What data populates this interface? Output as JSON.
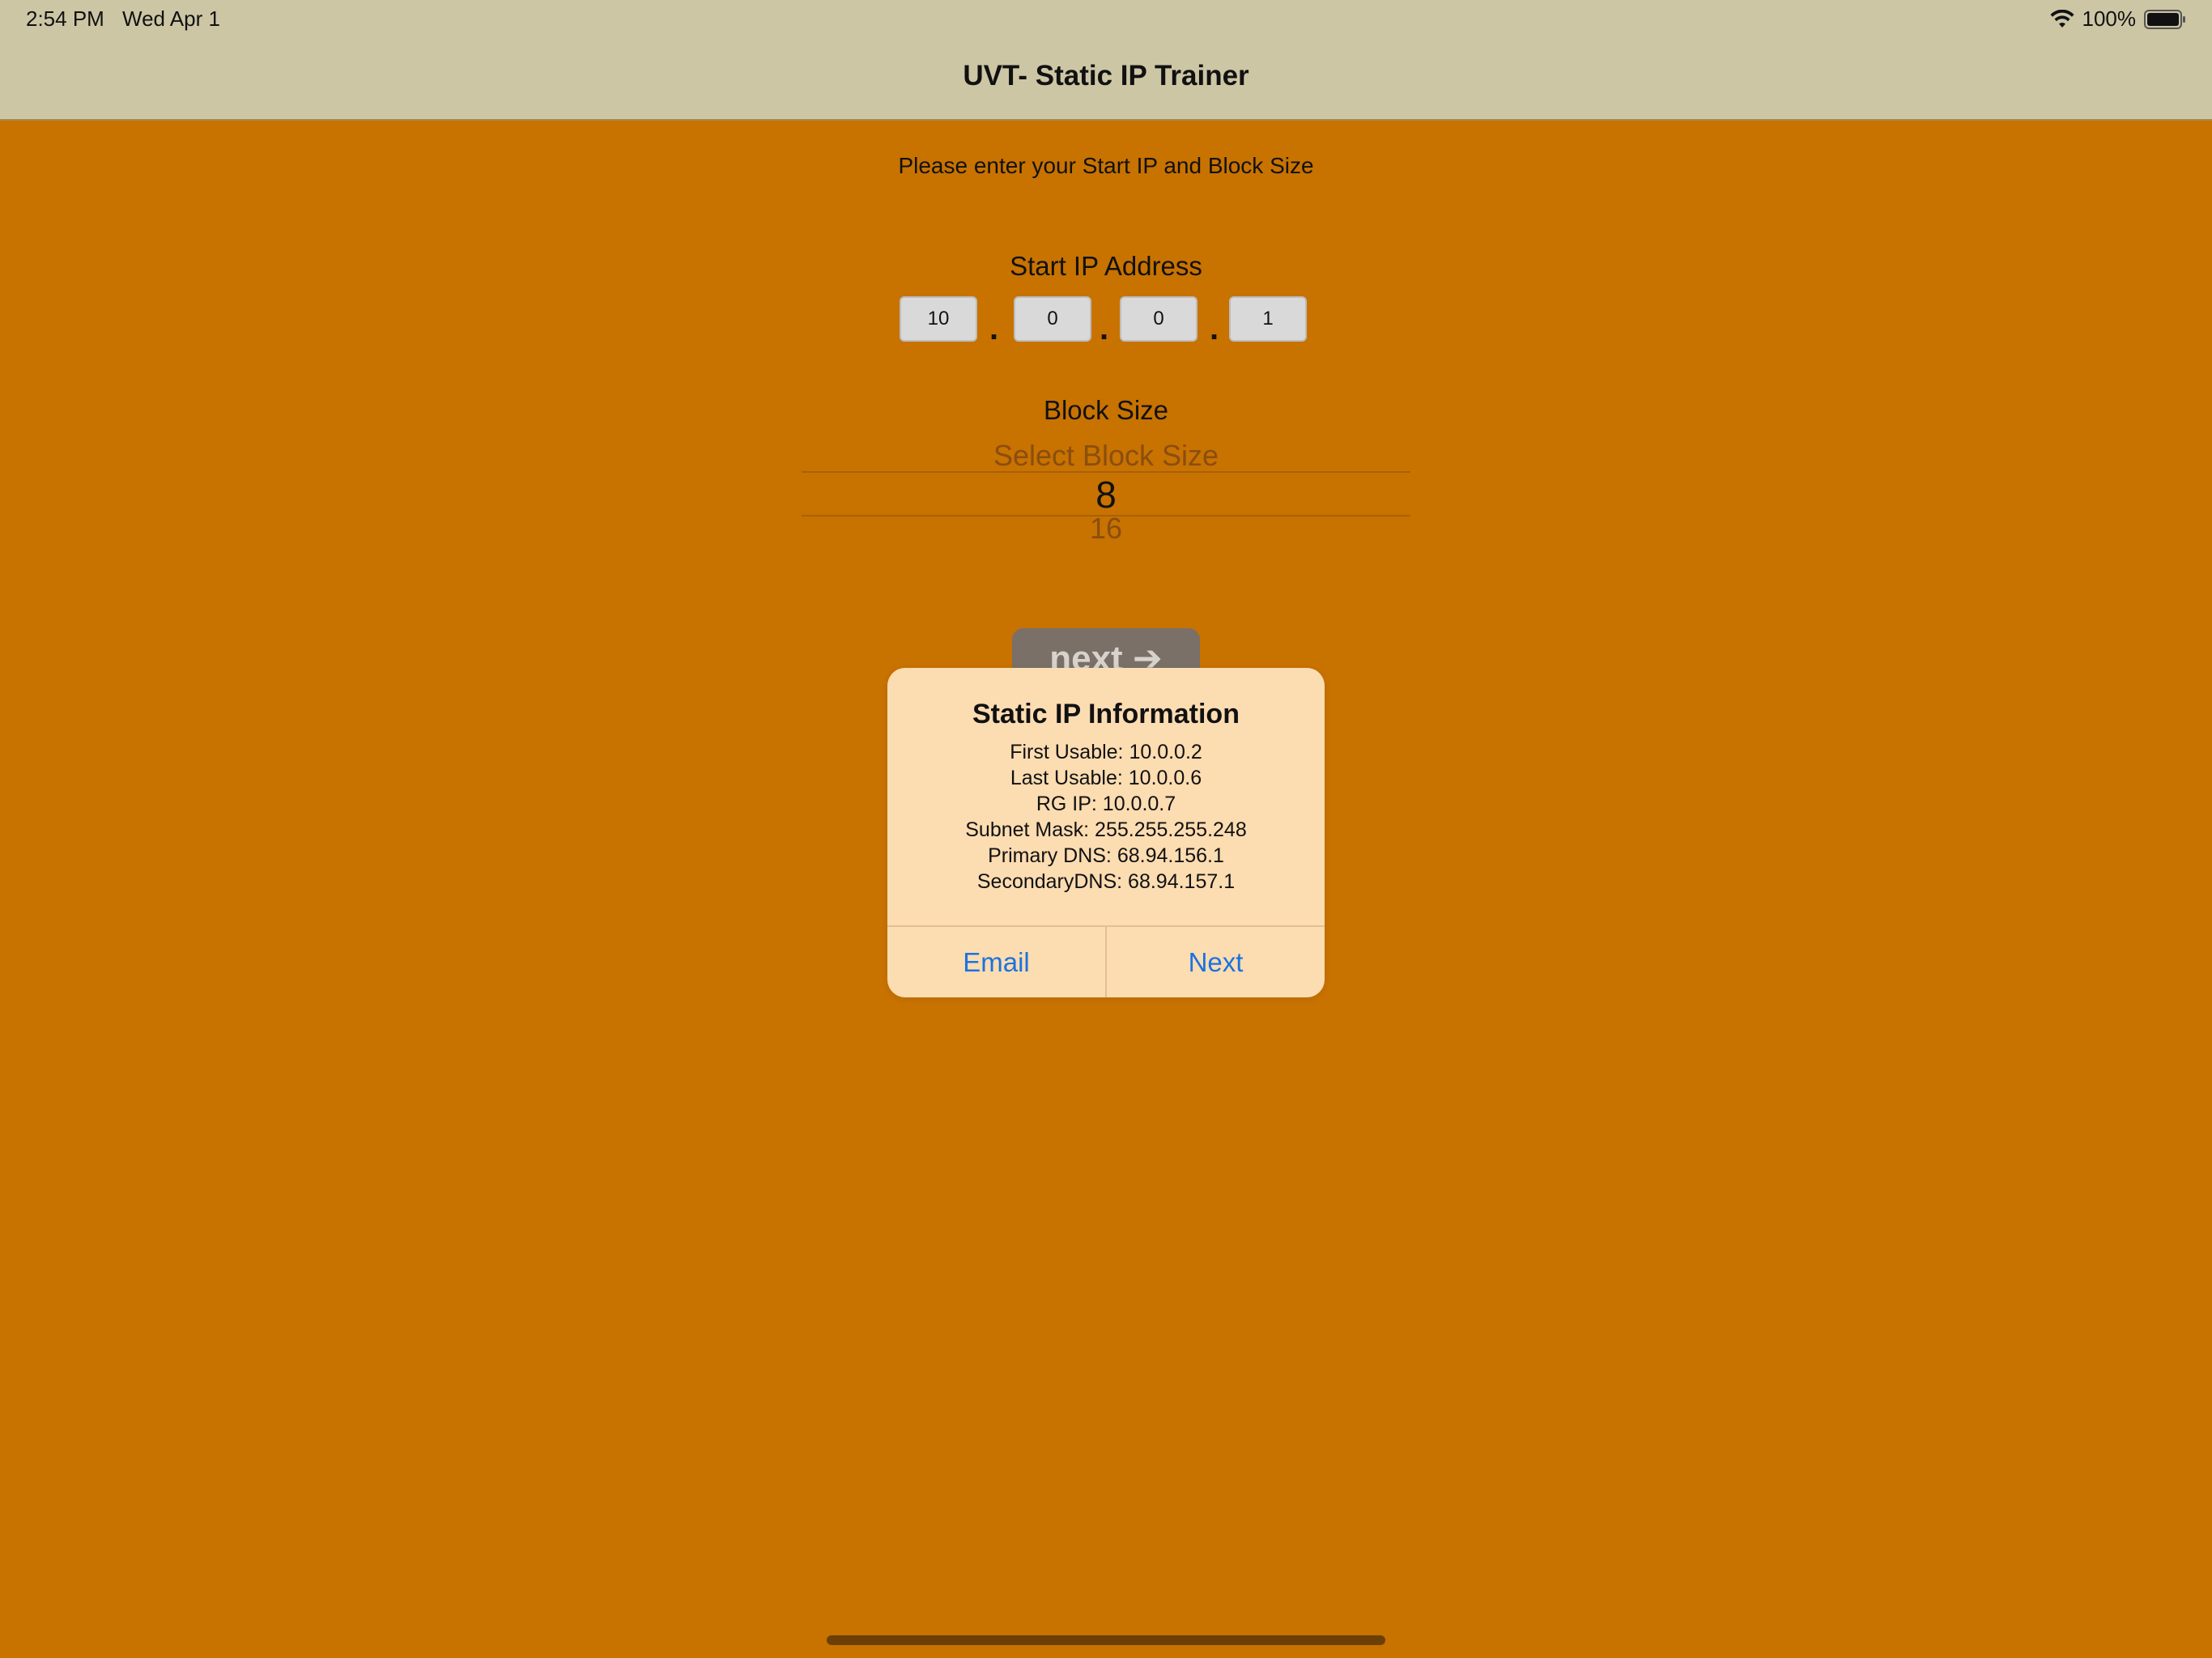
{
  "status_bar": {
    "time": "2:54 PM",
    "date": "Wed Apr 1",
    "battery": "100%",
    "icons": [
      "wifi-icon",
      "battery-icon"
    ]
  },
  "nav": {
    "title": "UVT- Static IP Trainer"
  },
  "main": {
    "instruction": "Please enter your Start IP and Block Size",
    "start_ip_label": "Start IP Address",
    "octets": [
      "10",
      "0",
      "0",
      "1"
    ],
    "dot": ".",
    "block_size_label": "Block Size",
    "picker": {
      "above": "Select Block Size",
      "selected": "8",
      "below": "16"
    },
    "next_button": "next ➔"
  },
  "alert": {
    "title": "Static IP Information",
    "lines": [
      "First Usable: 10.0.0.2",
      "Last Usable: 10.0.0.6",
      "RG IP: 10.0.0.7",
      "Subnet Mask: 255.255.255.248",
      "Primary DNS: 68.94.156.1",
      "SecondaryDNS: 68.94.157.1"
    ],
    "email_button": "Email",
    "next_button": "Next"
  },
  "colors": {
    "background": "#c87200",
    "navbar": "#cdc6a5",
    "alert_background": "#fcdcb1",
    "alert_button_text": "#1a73e0"
  }
}
